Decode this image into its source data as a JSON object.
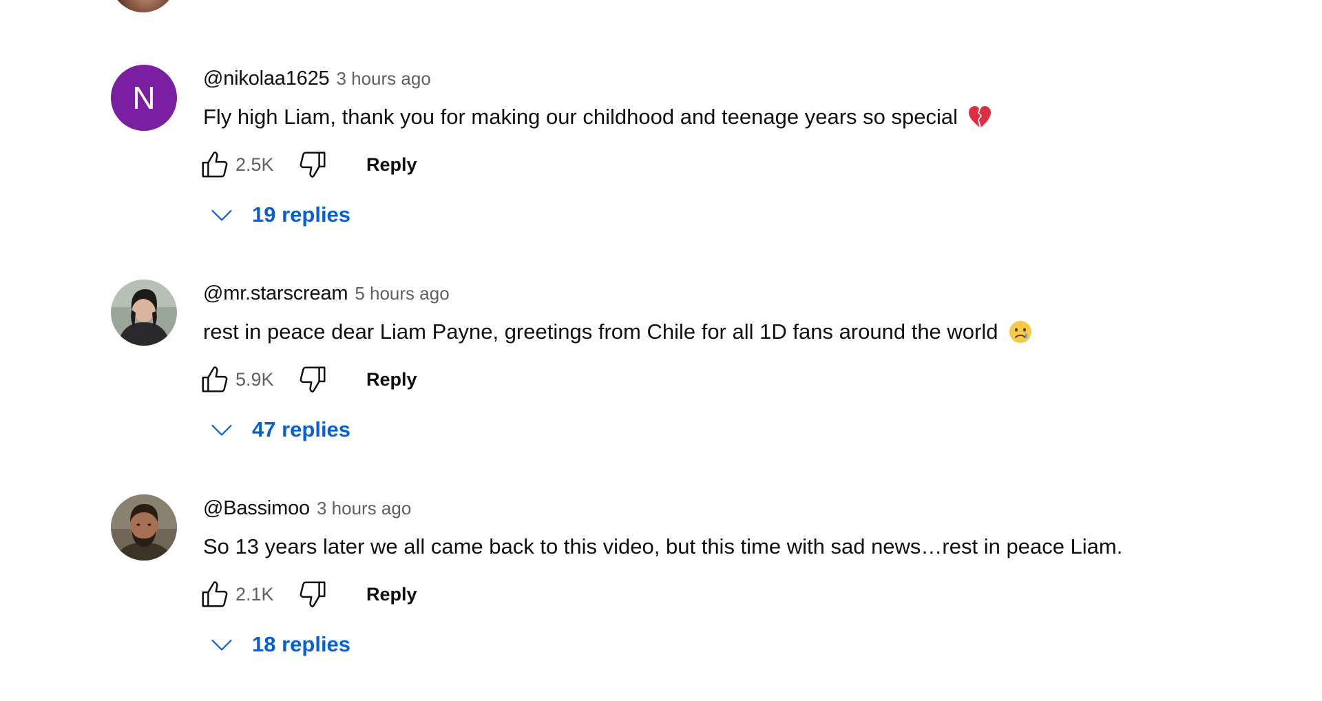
{
  "comments": [
    {
      "author": "@nikolaa1625",
      "time": "3 hours ago",
      "avatar_letter": "N",
      "avatar_color": "#7b1fa2",
      "text": "Fly high Liam, thank you for making our childhood and teenage years so special",
      "emoji": "broken-heart",
      "likes": "2.5K",
      "reply_label": "Reply",
      "replies_label": "19 replies"
    },
    {
      "author": "@mr.starscream",
      "time": "5 hours ago",
      "text": "rest in peace dear Liam Payne, greetings from Chile for all 1D fans around the world",
      "emoji": "crying-face",
      "likes": "5.9K",
      "reply_label": "Reply",
      "replies_label": "47 replies"
    },
    {
      "author": "@Bassimoo",
      "time": "3 hours ago",
      "text": "So 13 years later we all came back to this video, but this time with sad news…rest in peace Liam.",
      "likes": "2.1K",
      "reply_label": "Reply",
      "replies_label": "18 replies"
    }
  ],
  "colors": {
    "link_blue": "#065fd4",
    "secondary_text": "#606060",
    "primary_text": "#0f0f0f"
  },
  "icons": [
    "thumb-up-icon",
    "thumb-down-icon",
    "chevron-down-icon",
    "broken-heart-emoji",
    "crying-face-emoji"
  ]
}
